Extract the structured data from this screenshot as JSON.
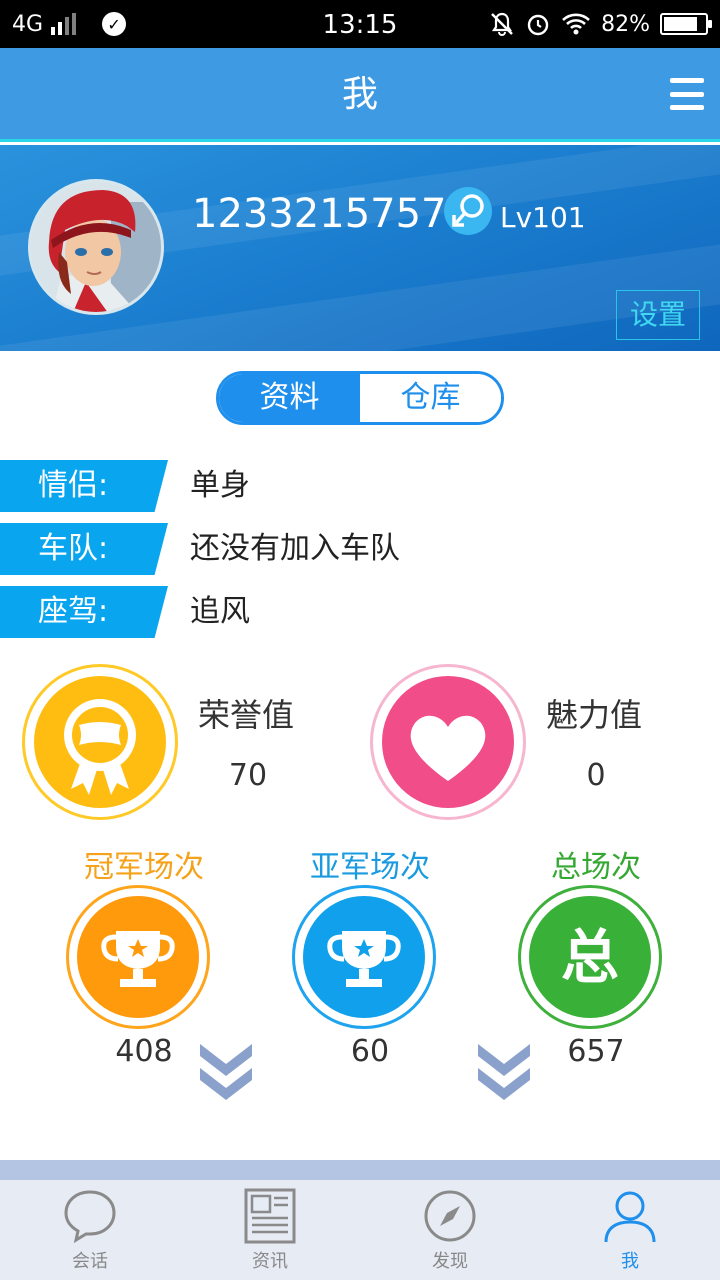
{
  "status_bar": {
    "network": "4G",
    "time": "13:15",
    "battery": "82%",
    "battery_level": 0.82
  },
  "header": {
    "title": "我",
    "menu_icon": "hamburger-menu-icon"
  },
  "profile": {
    "username": "12332157578",
    "gender_icon": "male-symbol-icon",
    "level": "Lv101",
    "settings_label": "设置"
  },
  "tabs": [
    {
      "label": "资料",
      "active": true
    },
    {
      "label": "仓库",
      "active": false
    }
  ],
  "info": [
    {
      "label": "情侣:",
      "value": "单身"
    },
    {
      "label": "车队:",
      "value": "还没有加入车队"
    },
    {
      "label": "座驾:",
      "value": "追风"
    }
  ],
  "stats": {
    "honor": {
      "title": "荣誉值",
      "value": "70",
      "icon": "honor-medal-icon",
      "color": "#ffc107"
    },
    "charm": {
      "title": "魅力值",
      "value": "0",
      "icon": "heart-icon",
      "color": "#f0508a"
    }
  },
  "counts": [
    {
      "title": "冠军场次",
      "value": "408",
      "icon": "gold-trophy-icon",
      "color": "#ff9c0d"
    },
    {
      "title": "亚军场次",
      "value": "60",
      "icon": "silver-trophy-icon",
      "color": "#14a0ec"
    },
    {
      "title": "总场次",
      "value": "657",
      "icon": "total-badge-icon",
      "color": "#3cb23a",
      "glyph": "总"
    }
  ],
  "bottom_nav": [
    {
      "label": "会话",
      "icon": "chat-bubble-icon",
      "active": false
    },
    {
      "label": "资讯",
      "icon": "news-icon",
      "active": false
    },
    {
      "label": "发现",
      "icon": "compass-icon",
      "active": false
    },
    {
      "label": "我",
      "icon": "user-icon",
      "active": true
    }
  ],
  "colors": {
    "header": "#3d9ae3",
    "accent": "#1e8fec",
    "label_bg": "#0aa5ef"
  }
}
